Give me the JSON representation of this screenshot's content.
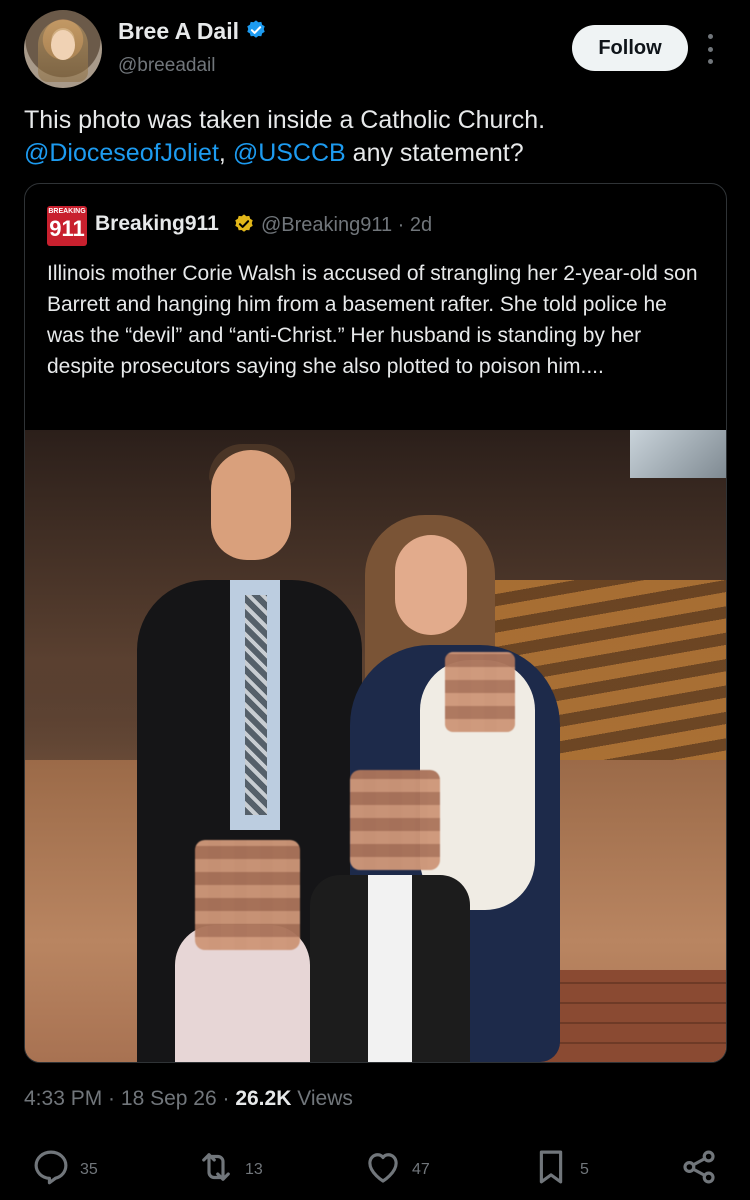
{
  "author": {
    "name": "Bree A Dail",
    "handle": "@breeadail",
    "verified_color": "#1d9bf0",
    "avatar_icon": "avatar-photo"
  },
  "follow_label": "Follow",
  "tweet": {
    "line1": "This photo was taken inside a Catholic Church.",
    "mention1": "@DioceseofJoliet",
    "sep": ", ",
    "mention2": "@USCCB",
    "tail": " any statement?"
  },
  "quote": {
    "logo_small": "BREAKING",
    "logo_big": "911",
    "name": "Breaking911",
    "verified_color": "#e2b719",
    "handle_time": "@Breaking911 · 2d",
    "text": "Illinois mother Corie Walsh is accused of strangling her 2-year-old son Barrett and hanging him from a basement rafter. She told police he was the “devil” and “anti-Christ.” Her husband is standing by her despite prosecutors saying she also plotted to poison him...."
  },
  "meta": {
    "time": "4:33 PM",
    "date": "18 Sep 26",
    "views_count": "26.2K",
    "views_label": "Views"
  },
  "actions": {
    "replies": "35",
    "reposts": "13",
    "likes": "47",
    "bookmarks": "5"
  },
  "colors": {
    "background": "#000000",
    "text": "#e7e9ea",
    "secondary": "#71767b",
    "link": "#1d9bf0",
    "border": "#2f3336"
  }
}
